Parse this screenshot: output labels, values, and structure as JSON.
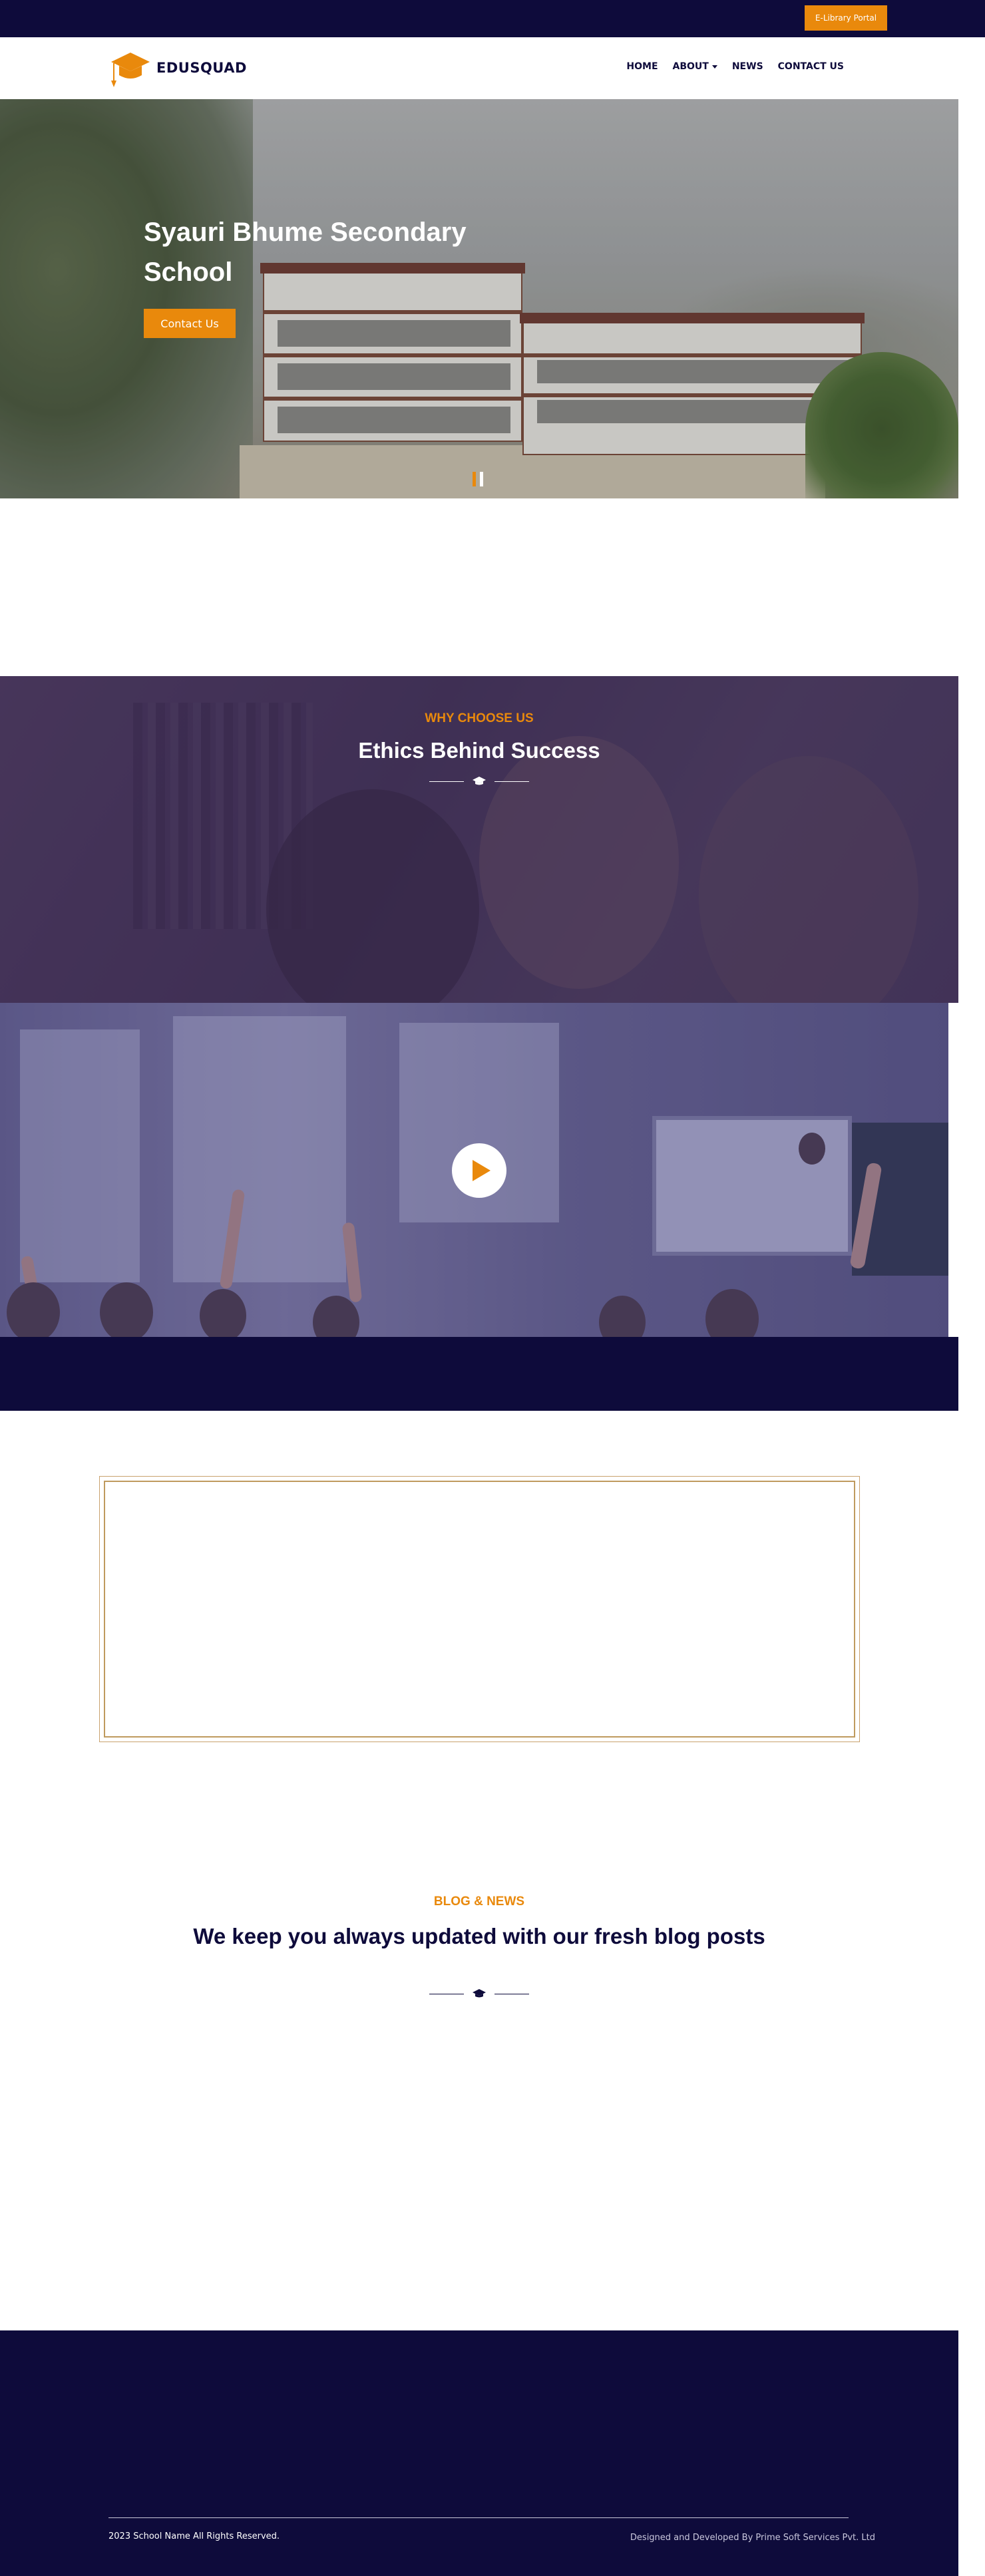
{
  "topbar": {
    "elibrary_label": "E-Library Portal"
  },
  "brand": {
    "name": "EDUSQUAD"
  },
  "nav": {
    "items": [
      {
        "label": "HOME"
      },
      {
        "label": "ABOUT"
      },
      {
        "label": "NEWS"
      },
      {
        "label": "CONTACT US"
      }
    ]
  },
  "hero": {
    "title": "Syauri Bhume Secondary School",
    "cta_label": "Contact Us",
    "slides": 2,
    "active_slide": 1
  },
  "why": {
    "kicker": "WHY CHOOSE US",
    "title": "Ethics Behind Success"
  },
  "blog": {
    "kicker": "BLOG & NEWS",
    "title": "We keep you always updated with our fresh blog posts"
  },
  "footer": {
    "copyright": "2023 School Name All Rights Reserved.",
    "credits": "Designed and Developed By Prime Soft Services Pvt. Ltd"
  },
  "colors": {
    "navy": "#0e0b3b",
    "accent": "#e9890c"
  }
}
